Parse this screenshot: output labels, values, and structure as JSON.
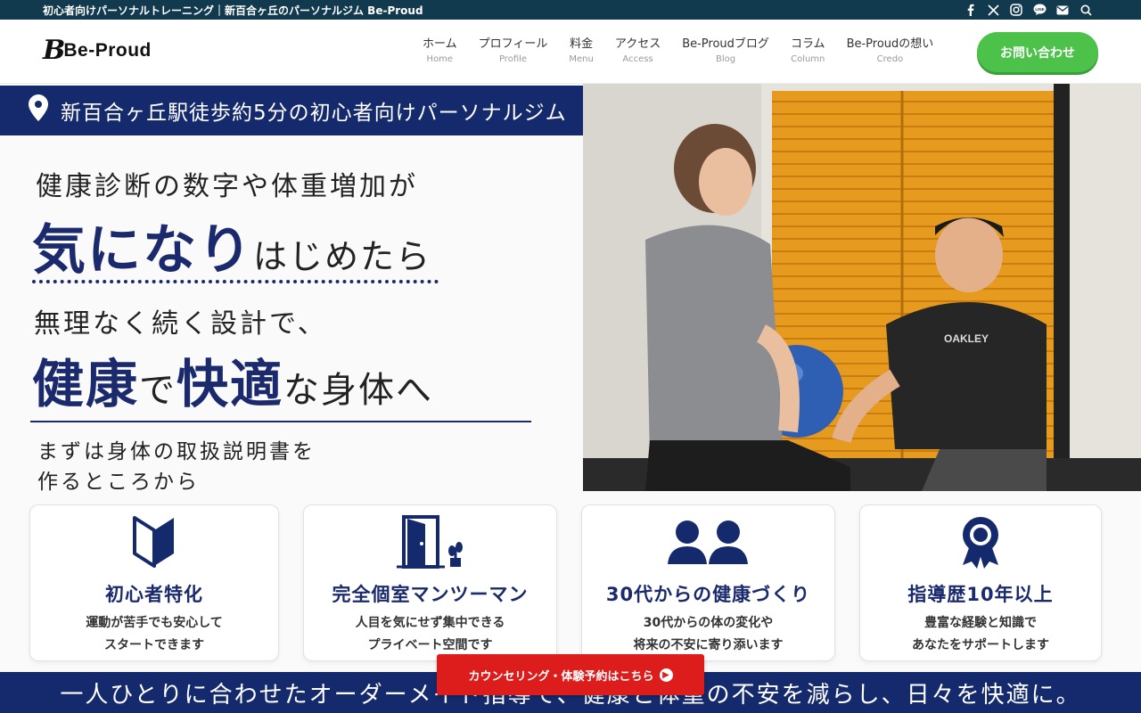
{
  "topbar": {
    "site_title": "初心者向けパーソナルトレーニング｜新百合ヶ丘のパーソナルジム Be-Proud",
    "socials": [
      "facebook-icon",
      "x-icon",
      "instagram-icon",
      "line-icon",
      "mail-icon",
      "search-icon"
    ]
  },
  "header": {
    "logo_mark": "B",
    "logo_text": "Be-Proud",
    "nav": [
      {
        "jp": "ホーム",
        "en": "Home"
      },
      {
        "jp": "プロフィール",
        "en": "Profile"
      },
      {
        "jp": "料金",
        "en": "Menu"
      },
      {
        "jp": "アクセス",
        "en": "Access"
      },
      {
        "jp": "Be-Proudブログ",
        "en": "Blog"
      },
      {
        "jp": "コラム",
        "en": "Column"
      },
      {
        "jp": "Be-Proudの想い",
        "en": "Credo"
      }
    ],
    "contact_button": "お問い合わせ"
  },
  "hero": {
    "location_banner": "新百合ヶ丘駅徒歩約5分の初心者向けパーソナルジム",
    "line1": "健康診断の数字や体重増加が",
    "line2_big": "気になり",
    "line2_small": "はじめたら",
    "line3": "無理なく続く設計で、",
    "line4_a": "健康",
    "line4_b": "で",
    "line4_c": "快適",
    "line4_d": "な身体へ",
    "line5_a": "まずは身体の取扱説明書を",
    "line5_b": "作るところから"
  },
  "features": [
    {
      "icon": "beginner-mark-icon",
      "title": "初心者特化",
      "desc1": "運動が苦手でも安心して",
      "desc2": "スタートできます"
    },
    {
      "icon": "private-room-door-icon",
      "title": "完全個室マンツーマン",
      "desc1": "人目を気にせず集中できる",
      "desc2": "プライベート空間です"
    },
    {
      "icon": "people-icon",
      "title": "30代からの健康づくり",
      "desc1": "30代からの体の変化や",
      "desc2": "将来の不安に寄り添います"
    },
    {
      "icon": "award-medal-icon",
      "title": "指導歴10年以上",
      "desc1": "豊富な経験と知識で",
      "desc2": "あなたをサポートします"
    }
  ],
  "bottom_band": "一人ひとりに合わせたオーダーメイド指導で、健康と体重の不安を減らし、日々を快適に。",
  "cta_bottom": "カウンセリング・体験予約はこちら",
  "colors": {
    "navy": "#152a6c",
    "green": "#4cc24a",
    "red": "#dd1c1c",
    "topbar": "#123a4e"
  }
}
